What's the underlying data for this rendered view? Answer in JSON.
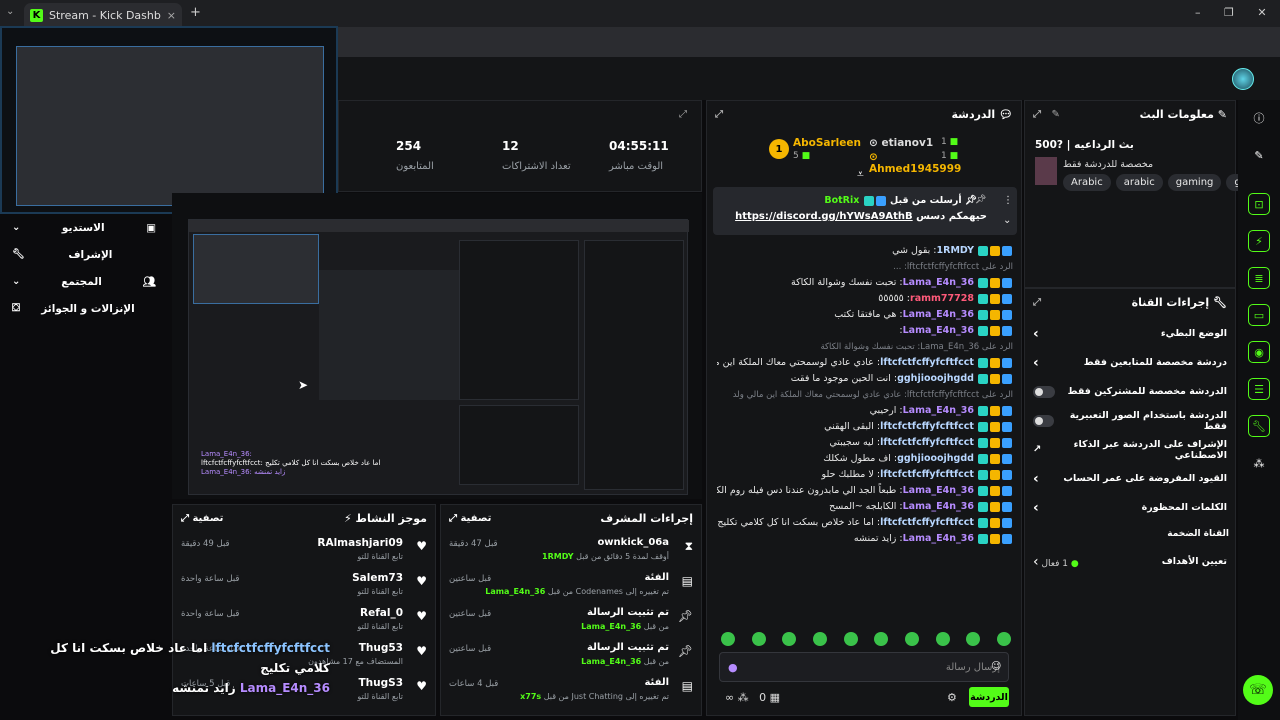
{
  "browser": {
    "tab_title": "Stream - Kick Dashboard",
    "tab_close": "×",
    "new_tab": "+"
  },
  "stats": [
    {
      "value": "04:55:11",
      "label": "الوقت مباشر"
    },
    {
      "value": "12",
      "label": "تعداد الاشتراكات"
    },
    {
      "value": "254",
      "label": "المتابعون"
    }
  ],
  "left_nav": [
    {
      "label": "الاستديو"
    },
    {
      "label": "الإشراف"
    },
    {
      "label": "المجتمع"
    },
    {
      "label": "الإنزالات و الجوائز"
    }
  ],
  "chat": {
    "title": "الدردشة",
    "top_gifters": {
      "rank1": "1",
      "name1": "AboSarleen",
      "count1": "5",
      "name2": "etianov1",
      "count2": "1",
      "name3": "Ahmed1945999",
      "count3": "1"
    },
    "pinned": {
      "sender_prefix": "أرسلت من قبل",
      "sender": "BotRix",
      "text_prefix": "حيهمكم دسس",
      "link": "https://discord.gg/hYWsA9AthB"
    },
    "messages": [
      {
        "user": "1RMDY",
        "text": "بقول شي",
        "cls": "user-b"
      },
      {
        "reply": "الرد على lftcfctfcffyfcftfcct: ..."
      },
      {
        "user": "Lama_E4n_36",
        "text": "تحبت نفسك وشوالة الكاكة",
        "cls": "user-p"
      },
      {
        "user": "ramm77728",
        "text": "٥٥٥٥٥",
        "cls": "user-r"
      },
      {
        "user": "Lama_E4n_36",
        "text": "هي مافتقا تكتب",
        "cls": "user-p"
      },
      {
        "user": "Lama_E4n_36",
        "text": "",
        "cls": "user-p"
      },
      {
        "reply": "الرد على Lama_E4n_36: تحبت نفسك وشوالة الكاكة"
      },
      {
        "user": "lftcfctfcffyfcftfcct",
        "text": "عادي عادي لوسمحتي معاك الملكة اين مالي ولد",
        "cls": "user-b"
      },
      {
        "user": "gghjiooojhgdd",
        "text": "انت الحين موجود ما فقت",
        "cls": "user-b"
      },
      {
        "reply": "الرد على lftcfctfcffyfcftfcct: عادي عادي لوسمحتي معاك الملكة اين مالي ولد"
      },
      {
        "user": "Lama_E4n_36",
        "text": "ارحيبي",
        "cls": "user-p"
      },
      {
        "user": "lftcfctfcffyfcftfcct",
        "text": "البقى الهقني",
        "cls": "user-b"
      },
      {
        "user": "lftcfctfcffyfcftfcct",
        "text": "ليه سجيبتي",
        "cls": "user-b"
      },
      {
        "user": "gghjiooojhgdd",
        "text": "اف مطول شكلك",
        "cls": "user-b"
      },
      {
        "user": "lftcfctfcffyfcftfcct",
        "text": "لا مطلبك حلو",
        "cls": "user-b"
      },
      {
        "user": "Lama_E4n_36",
        "text": "طبعاً الجد الي مابدرون عندنا دس فيله روم الكابلجات اي شخص يكلع بالتدات حتى لو الاستريمر نكتبه بالكابلجات",
        "cls": "user-p"
      },
      {
        "user": "Lama_E4n_36",
        "text": "الكابلجه ~المسح",
        "cls": "user-p"
      },
      {
        "user": "lftcfctfcffyfcftfcct",
        "text": "اما عاد خلاص بسكت انا كل كلامي تكليج",
        "cls": "user-b"
      },
      {
        "user": "Lama_E4n_36",
        "text": "زايد تمنشه",
        "cls": "user-p"
      }
    ],
    "input_placeholder": "إرسال رسالة",
    "send": "الدردشة",
    "points": "0"
  },
  "stream_info": {
    "title": "معلومات البث",
    "stream_title": "بث الرداعيه | ?500",
    "subtitle": "مخصصة للدردشة فقط",
    "tags": [
      "Arabic",
      "arabic",
      "gaming",
      "gta"
    ]
  },
  "channel_actions": {
    "title": "إجراءات القناة",
    "rows": [
      {
        "label": "الوضع البطيء",
        "type": "chev"
      },
      {
        "label": "دردشة مخصصة للمتابعين فقط",
        "type": "chev"
      },
      {
        "label": "الدردشة مخصصة للمشتركين فقط",
        "type": "toggle"
      },
      {
        "label": "الدردشة باستخدام الصور التعبيرية فقط",
        "type": "toggle"
      },
      {
        "label": "الإشراف على الدردشة عبر الذكاء الاصطناعي",
        "type": "ext"
      },
      {
        "label": "القيود المفروضة على عمر الحساب",
        "type": "chev"
      },
      {
        "label": "الكلمات المحظورة",
        "type": "chev"
      }
    ],
    "section": "القناة الضخمة",
    "goal_label": "تعيين الأهداف",
    "goal_value": "1 فعال"
  },
  "activity": {
    "title": "موجز النشاط",
    "filter": "تصفية",
    "rows": [
      {
        "name": "RAlmashjari09",
        "sub": "تابع القناة للتو",
        "time": "قبل 49 دقيقة"
      },
      {
        "name": "Salem73",
        "sub": "تابع القناة للتو",
        "time": "قبل ساعة واحدة"
      },
      {
        "name": "Refal_0",
        "sub": "تابع القناة للتو",
        "time": "قبل ساعة واحدة"
      },
      {
        "name": "Thug53",
        "sub": "المستضاف مع 17 مشاهدون",
        "time": "قبل ساعة واحدة"
      },
      {
        "name": "ThugS3",
        "sub": "تابع القناة للتو",
        "time": "قبل 5 ساعات"
      }
    ]
  },
  "modactions": {
    "title": "إجراءات المشرف",
    "filter": "تصفية",
    "rows": [
      {
        "name": "ownkick_06a",
        "sub_prefix": "أوقف لمدة 5 دقائق من قبل",
        "sub_user": "1RMDY",
        "time": "قبل 47 دقيقة"
      },
      {
        "name": "الفئة",
        "sub_prefix": "تم تغييره إلى Codenames من قبل",
        "sub_user": "Lama_E4n_36",
        "time": "قبل ساعتين"
      },
      {
        "name": "تم تثبيت الرسالة",
        "sub_prefix": "من قبل",
        "sub_user": "Lama_E4n_36",
        "time": "قبل ساعتين"
      },
      {
        "name": "تم تثبيت الرسالة",
        "sub_prefix": "من قبل",
        "sub_user": "Lama_E4n_36",
        "time": "قبل ساعتين"
      },
      {
        "name": "الفئة",
        "sub_prefix": "تم تغييره إلى Just Chatting من قبل",
        "sub_user": "x77s",
        "time": "قبل 4 ساعات"
      }
    ]
  },
  "overlay": {
    "line1_user": "lftcfctfcffyfcftfcct",
    "line1_text": "اما عاد خلاص بسكت انا كل كلامي تكليج",
    "line2_user": "Lama_E4n_36",
    "line2_text": "زايد تمنشه",
    "mini_lines": [
      "Lama_E4n_36:",
      "lftcfctfcffyfcftfcct: اما عاد خلاص بسكت انا كل كلامي تكليج",
      "Lama_E4n_36: زايد تمنشه"
    ]
  }
}
